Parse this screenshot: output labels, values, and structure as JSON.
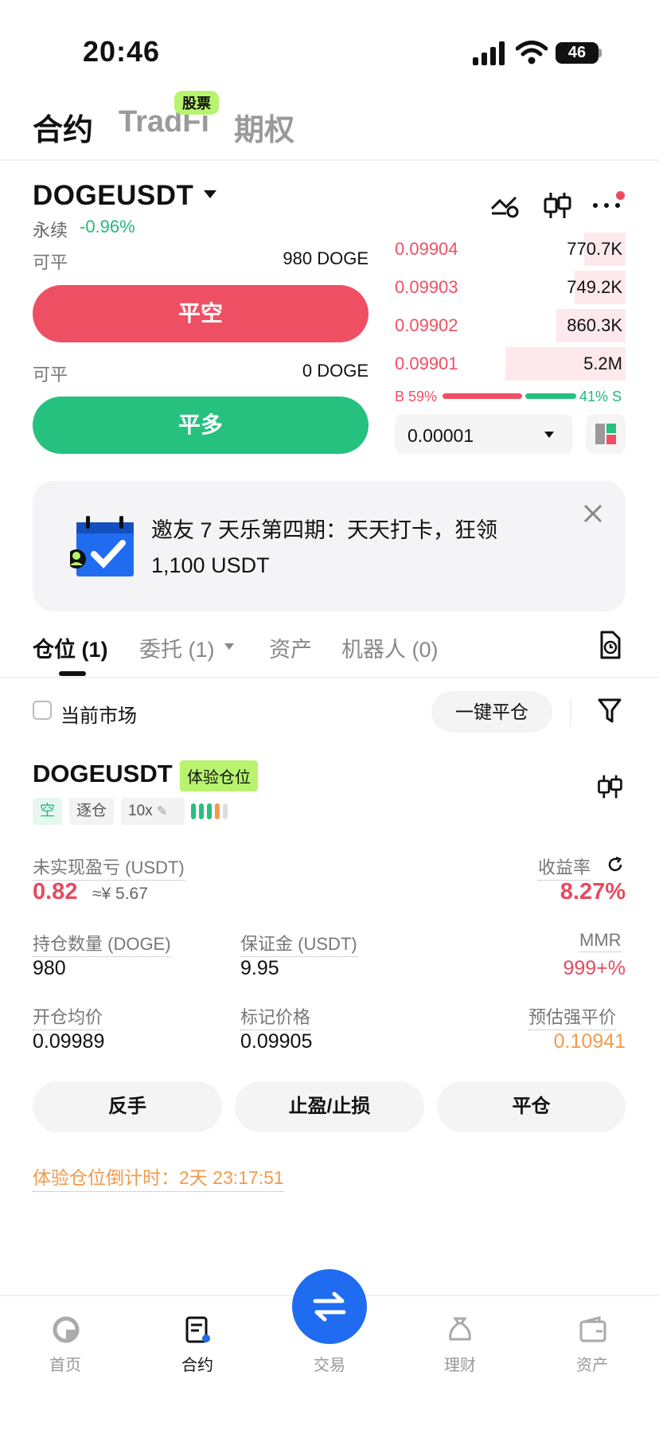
{
  "status": {
    "time": "20:46",
    "battery": "46"
  },
  "top_tabs": {
    "contract": "合约",
    "tradfi": "TradFi",
    "tradfi_badge": "股票",
    "options": "期权"
  },
  "header": {
    "pair": "DOGEUSDT",
    "perpetual": "永续",
    "change": "-0.96%"
  },
  "close_panel": {
    "short_available_label": "可平",
    "short_available_value": "980 DOGE",
    "short_button": "平空",
    "long_available_label": "可平",
    "long_available_value": "0 DOGE",
    "long_button": "平多"
  },
  "orderbook": {
    "rows": [
      {
        "price": "0.09904",
        "qty": "770.7K",
        "depth": 0.18
      },
      {
        "price": "0.09903",
        "qty": "749.2K",
        "depth": 0.22
      },
      {
        "price": "0.09902",
        "qty": "860.3K",
        "depth": 0.3
      },
      {
        "price": "0.09901",
        "qty": "5.2M",
        "depth": 0.52
      }
    ],
    "buy_ratio": "B 59%",
    "sell_ratio": "41% S",
    "tick_size": "0.00001"
  },
  "banner": {
    "text": "邀友 7 天乐第四期：天天打卡，狂领 1,100 USDT"
  },
  "position_tabs": {
    "positions": "仓位 (1)",
    "orders": "委托 (1)",
    "assets": "资产",
    "bots": "机器人 (0)"
  },
  "filter": {
    "current_market": "当前市场",
    "close_all": "一键平仓"
  },
  "position": {
    "pair": "DOGEUSDT",
    "trial_badge": "体验仓位",
    "side": "空",
    "margin_mode": "逐仓",
    "leverage": "10x",
    "upnl_label": "未实现盈亏 (USDT)",
    "upnl_value": "0.82",
    "upnl_cny": "≈¥ 5.67",
    "roe_label": "收益率",
    "roe_value": "8.27%",
    "qty_label": "持仓数量 (DOGE)",
    "qty_value": "980",
    "margin_label": "保证金 (USDT)",
    "margin_value": "9.95",
    "mmr_label": "MMR",
    "mmr_value": "999+%",
    "entry_label": "开仓均价",
    "entry_value": "0.09989",
    "mark_label": "标记价格",
    "mark_value": "0.09905",
    "liq_label": "预估强平价",
    "liq_value": "0.10941",
    "reverse_button": "反手",
    "tpsl_button": "止盈/止损",
    "close_button": "平仓",
    "countdown": "体验仓位倒计时：2天 23:17:51"
  },
  "nav": {
    "home": "首页",
    "contract": "合约",
    "trade": "交易",
    "finance": "理财",
    "assets": "资产"
  },
  "colors": {
    "red": "#ef4f62",
    "green": "#26c07f",
    "orange": "#f39a4b",
    "blue": "#1f6cf0",
    "badge": "#b7f36d"
  }
}
